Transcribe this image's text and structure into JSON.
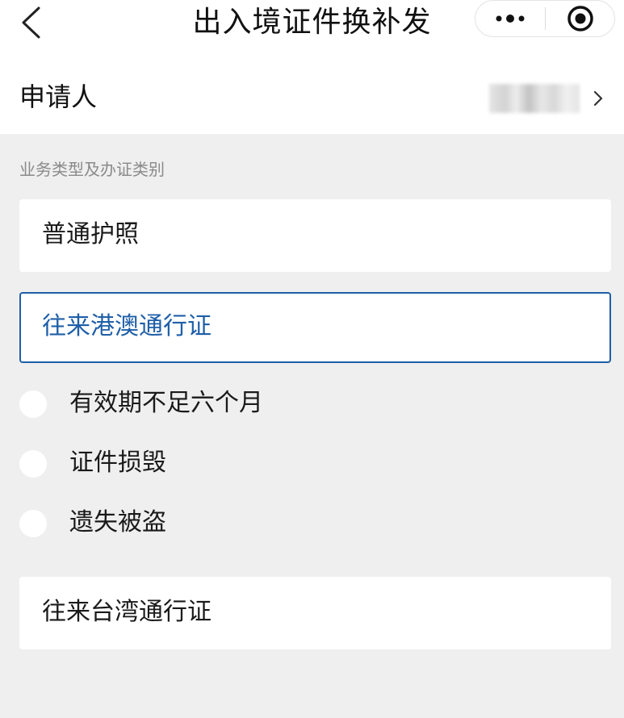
{
  "header": {
    "title": "出入境证件换补发",
    "back_icon": "chevron-left-icon",
    "more_icon": "more-dots-icon",
    "close_icon": "target-circle-icon"
  },
  "applicant": {
    "label": "申请人",
    "chevron_icon": "chevron-right-icon"
  },
  "section": {
    "label": "业务类型及办证类别"
  },
  "cards": {
    "passport": "普通护照",
    "hk_macau": "往来港澳通行证",
    "taiwan": "往来台湾通行证"
  },
  "options": [
    {
      "label": "有效期不足六个月",
      "checked": false
    },
    {
      "label": "证件损毁",
      "checked": false
    },
    {
      "label": "遗失被盗",
      "checked": false
    }
  ],
  "colors": {
    "accent": "#1f5fa8",
    "background": "#efefef",
    "card": "#ffffff",
    "muted_text": "#8a8a8a"
  }
}
